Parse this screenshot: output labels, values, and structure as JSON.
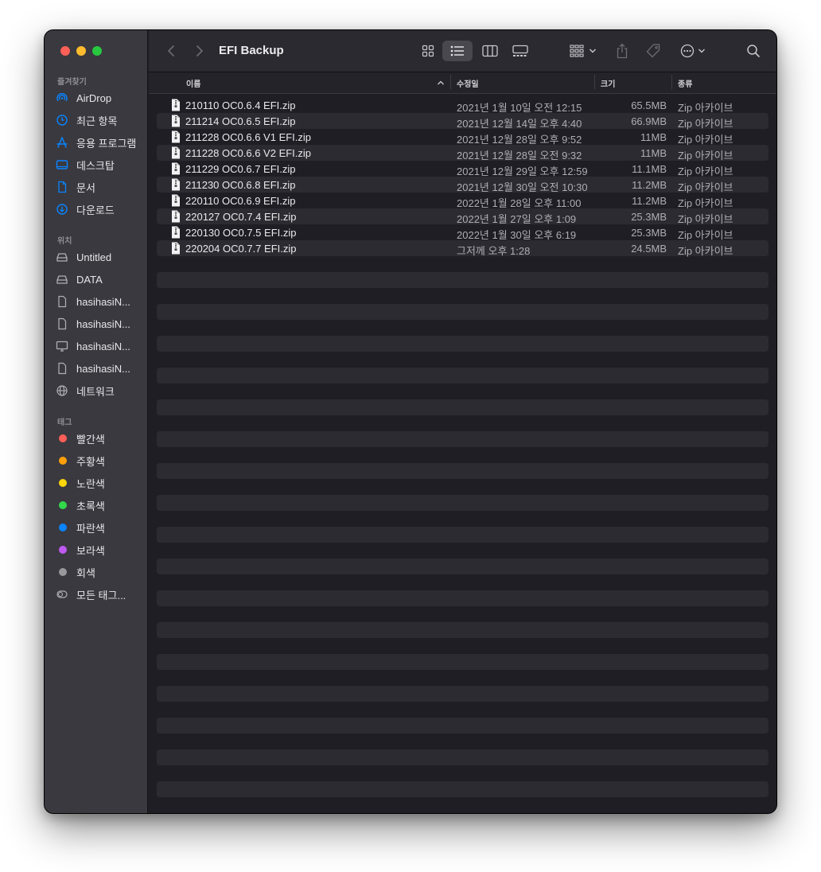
{
  "window": {
    "title": "EFI Backup"
  },
  "sidebar": {
    "favorites_header": "즐겨찾기",
    "favorites": [
      {
        "label": "AirDrop",
        "icon": "airdrop-icon"
      },
      {
        "label": "최근 항목",
        "icon": "clock-icon"
      },
      {
        "label": "응용 프로그램",
        "icon": "applications-icon"
      },
      {
        "label": "데스크탑",
        "icon": "desktop-icon"
      },
      {
        "label": "문서",
        "icon": "document-icon"
      },
      {
        "label": "다운로드",
        "icon": "download-icon"
      }
    ],
    "locations_header": "위치",
    "locations": [
      {
        "label": "Untitled",
        "icon": "drive-icon"
      },
      {
        "label": "DATA",
        "icon": "drive-icon"
      },
      {
        "label": "hasihasiN...",
        "icon": "file-icon"
      },
      {
        "label": "hasihasiN...",
        "icon": "file-icon"
      },
      {
        "label": "hasihasiN...",
        "icon": "monitor-icon"
      },
      {
        "label": "hasihasiN...",
        "icon": "file-icon"
      },
      {
        "label": "네트워크",
        "icon": "network-icon"
      }
    ],
    "tags_header": "태그",
    "tags": [
      {
        "label": "빨간색",
        "color": "#fe5f57"
      },
      {
        "label": "주황색",
        "color": "#ff9f0a"
      },
      {
        "label": "노란색",
        "color": "#ffd60a"
      },
      {
        "label": "초록색",
        "color": "#32d74b"
      },
      {
        "label": "파란색",
        "color": "#0a84ff"
      },
      {
        "label": "보라색",
        "color": "#bf5af2"
      },
      {
        "label": "회색",
        "color": "#98989d"
      },
      {
        "label": "모든 태그...",
        "color": ""
      }
    ]
  },
  "columns": {
    "name": "이름",
    "date": "수정일",
    "size": "크기",
    "kind": "종류"
  },
  "files": [
    {
      "name": "210110 OC0.6.4 EFI.zip",
      "date": "2021년 1월 10일 오전 12:15",
      "size": "65.5MB",
      "kind": "Zip 아카이브"
    },
    {
      "name": "211214 OC0.6.5 EFI.zip",
      "date": "2021년 12월 14일 오후 4:40",
      "size": "66.9MB",
      "kind": "Zip 아카이브"
    },
    {
      "name": "211228 OC0.6.6 V1 EFI.zip",
      "date": "2021년 12월 28일 오후 9:52",
      "size": "11MB",
      "kind": "Zip 아카이브"
    },
    {
      "name": "211228 OC0.6.6 V2 EFI.zip",
      "date": "2021년 12월 28일 오전 9:32",
      "size": "11MB",
      "kind": "Zip 아카이브"
    },
    {
      "name": "211229 OC0.6.7 EFI.zip",
      "date": "2021년 12월 29일 오후 12:59",
      "size": "11.1MB",
      "kind": "Zip 아카이브"
    },
    {
      "name": "211230 OC0.6.8 EFI.zip",
      "date": "2021년 12월 30일 오전 10:30",
      "size": "11.2MB",
      "kind": "Zip 아카이브"
    },
    {
      "name": "220110 OC0.6.9 EFI.zip",
      "date": "2022년 1월 28일 오후 11:00",
      "size": "11.2MB",
      "kind": "Zip 아카이브"
    },
    {
      "name": "220127 OC0.7.4 EFI.zip",
      "date": "2022년 1월 27일 오후 1:09",
      "size": "25.3MB",
      "kind": "Zip 아카이브"
    },
    {
      "name": "220130 OC0.7.5 EFI.zip",
      "date": "2022년 1월 30일 오후 6:19",
      "size": "25.3MB",
      "kind": "Zip 아카이브"
    },
    {
      "name": "220204 OC0.7.7 EFI.zip",
      "date": "그저께 오후 1:28",
      "size": "24.5MB",
      "kind": "Zip 아카이브"
    }
  ]
}
